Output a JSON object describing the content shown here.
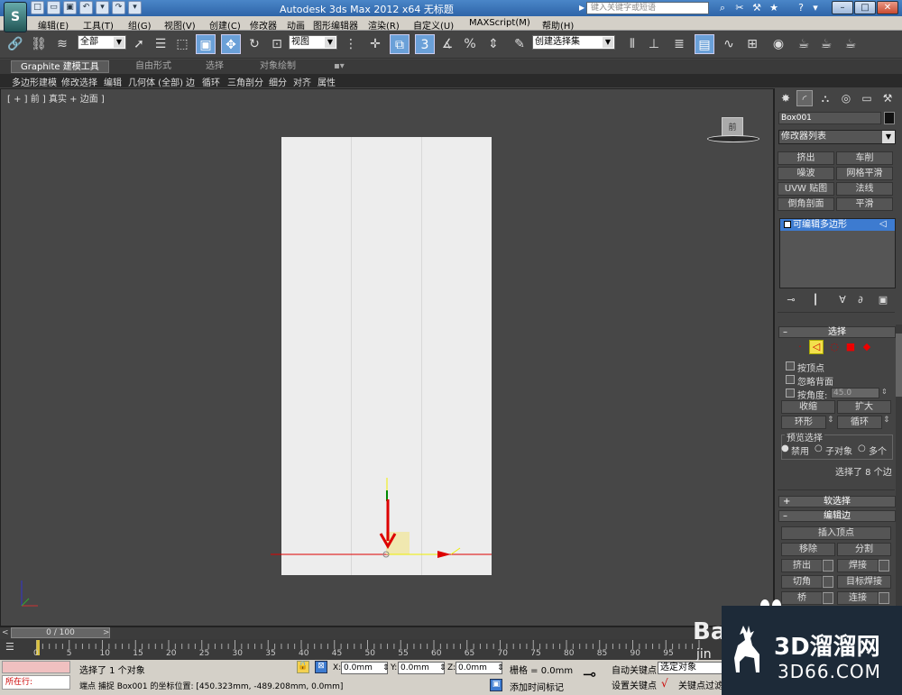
{
  "titlebar": {
    "logo_text": "S",
    "title": "Autodesk 3ds Max  2012 x64      无标题",
    "search_placeholder": "键入关键字或短语",
    "win_min": "–",
    "win_max": "□",
    "win_close": "✕"
  },
  "menu": [
    "编辑(E)",
    "工具(T)",
    "组(G)",
    "视图(V)",
    "创建(C)",
    "修改器",
    "动画",
    "图形编辑器",
    "渲染(R)",
    "自定义(U)",
    "MAXScript(M)",
    "帮助(H)"
  ],
  "toolbar": {
    "selection_filter": "全部",
    "ref_coord": "视图",
    "named_selection": "创建选择集"
  },
  "ribbon": {
    "tabs": [
      "Graphite 建模工具",
      "自由形式",
      "选择",
      "对象绘制"
    ],
    "sub_items": [
      "多边形建模",
      "修改选择",
      "编辑",
      "几何体 (全部)",
      "边",
      "循环",
      "三角剖分",
      "细分",
      "对齐",
      "属性"
    ]
  },
  "viewport": {
    "label": "[ + ] 前 ] 真实 + 边面 ]",
    "viewcube_label": "前"
  },
  "command_panel": {
    "object_name": "Box001",
    "modifier_list": "修改器列表",
    "modifier_buttons": [
      "挤出",
      "车削",
      "噪波",
      "网格平滑",
      "UVW 贴图",
      "法线",
      "倒角剖面",
      "平滑"
    ],
    "stack_item": "可编辑多边形",
    "selection_rollout": {
      "title": "选择",
      "by_vertex": "按顶点",
      "ignore_backface": "忽略背面",
      "by_angle": "按角度:",
      "angle_value": "45.0",
      "shrink": "收缩",
      "grow": "扩大",
      "ring": "环形",
      "loop": "循环",
      "preview_label": "预览选择",
      "preview_options": [
        "禁用",
        "子对象",
        "多个"
      ],
      "status": "选择了 8 个边"
    },
    "soft_selection": "软选择",
    "edit_edges": {
      "title": "编辑边",
      "insert_vertex": "插入顶点",
      "remove": "移除",
      "split": "分割",
      "extrude": "挤出",
      "weld": "焊接",
      "chamfer": "切角",
      "target_weld": "目标焊接",
      "bridge": "桥",
      "connect": "连接"
    }
  },
  "timeline": {
    "frame_display": "0 / 100",
    "ticks": [
      "0",
      "5",
      "10",
      "15",
      "20",
      "25",
      "30",
      "35",
      "40",
      "45",
      "50",
      "55",
      "60",
      "65",
      "70",
      "75",
      "80",
      "85",
      "90",
      "95"
    ]
  },
  "status": {
    "maxscript_label": "所在行:",
    "selected_text": "选择了 1 个对象",
    "prompt_text": "端点 捕捉 Box001 的坐标位置: [450.323mm, -489.208mm, 0.0mm]",
    "x_label": "X:",
    "x_value": "0.0mm",
    "y_label": "Y:",
    "y_value": "0.0mm",
    "z_label": "Z:",
    "z_value": "0.0mm",
    "grid_text": "栅格 = 0.0mm",
    "add_time_tag": "添加时间标记",
    "auto_key": "自动关键点",
    "selected_object": "选定对象",
    "set_key": "设置关键点",
    "key_filters": "关键点过滤"
  },
  "watermark": {
    "big": "3D溜溜网",
    "small": "3D66.COM",
    "baidu": "Ba",
    "jy": "jin"
  }
}
